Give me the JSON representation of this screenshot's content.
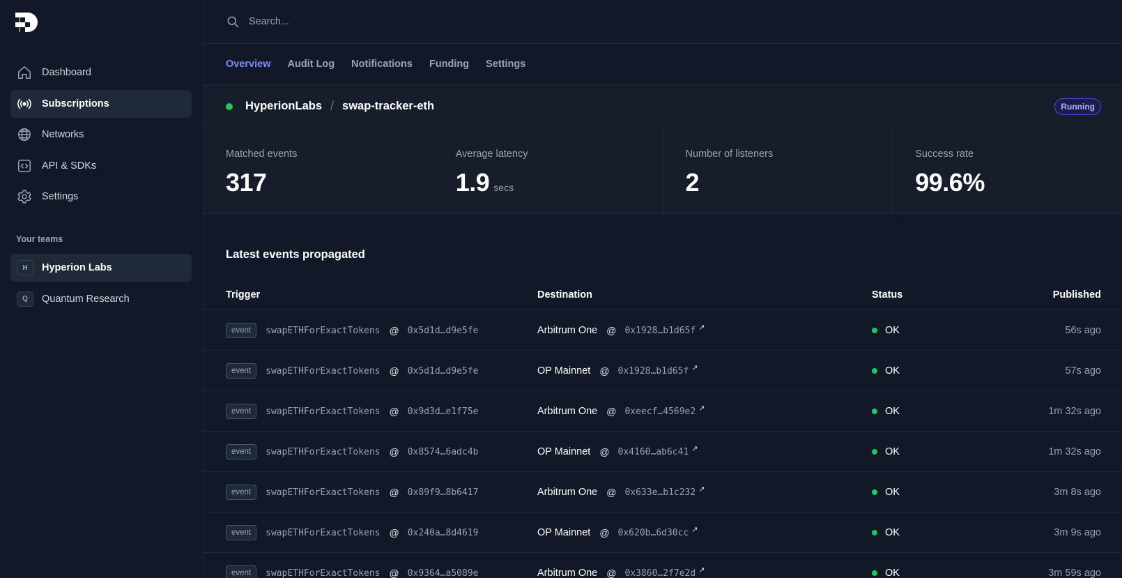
{
  "search": {
    "placeholder": "Search..."
  },
  "sidebar": {
    "nav": [
      {
        "label": "Dashboard",
        "icon": "home-icon"
      },
      {
        "label": "Subscriptions",
        "icon": "broadcast-icon",
        "active": true
      },
      {
        "label": "Networks",
        "icon": "globe-icon"
      },
      {
        "label": "API & SDKs",
        "icon": "code-icon"
      },
      {
        "label": "Settings",
        "icon": "gear-icon"
      }
    ],
    "teams_label": "Your teams",
    "teams": [
      {
        "initial": "H",
        "label": "Hyperion Labs",
        "active": true
      },
      {
        "initial": "Q",
        "label": "Quantum Research"
      }
    ]
  },
  "tabs": [
    {
      "label": "Overview",
      "active": true
    },
    {
      "label": "Audit Log"
    },
    {
      "label": "Notifications"
    },
    {
      "label": "Funding"
    },
    {
      "label": "Settings"
    }
  ],
  "header": {
    "org": "HyperionLabs",
    "separator": "/",
    "subscription": "swap-tracker-eth",
    "status": "Running"
  },
  "stats": [
    {
      "label": "Matched events",
      "value": "317",
      "unit": ""
    },
    {
      "label": "Average latency",
      "value": "1.9",
      "unit": "secs"
    },
    {
      "label": "Number of listeners",
      "value": "2",
      "unit": ""
    },
    {
      "label": "Success rate",
      "value": "99.6%",
      "unit": ""
    }
  ],
  "events": {
    "title": "Latest events propagated",
    "columns": {
      "trigger": "Trigger",
      "destination": "Destination",
      "status": "Status",
      "published": "Published"
    },
    "rows": [
      {
        "tag": "event",
        "fn": "swapETHForExactTokens",
        "at": "@",
        "src": "0x5d1d…d9e5fe",
        "dest": "Arbitrum One",
        "dest_addr": "0x1928…b1d65f",
        "status": "OK",
        "published": "56s ago"
      },
      {
        "tag": "event",
        "fn": "swapETHForExactTokens",
        "at": "@",
        "src": "0x5d1d…d9e5fe",
        "dest": "OP Mainnet",
        "dest_addr": "0x1928…b1d65f",
        "status": "OK",
        "published": "57s ago"
      },
      {
        "tag": "event",
        "fn": "swapETHForExactTokens",
        "at": "@",
        "src": "0x9d3d…e1f75e",
        "dest": "Arbitrum One",
        "dest_addr": "0xeecf…4569e2",
        "status": "OK",
        "published": "1m 32s ago"
      },
      {
        "tag": "event",
        "fn": "swapETHForExactTokens",
        "at": "@",
        "src": "0x8574…6adc4b",
        "dest": "OP Mainnet",
        "dest_addr": "0x4160…ab6c41",
        "status": "OK",
        "published": "1m 32s ago"
      },
      {
        "tag": "event",
        "fn": "swapETHForExactTokens",
        "at": "@",
        "src": "0x89f9…8b6417",
        "dest": "Arbitrum One",
        "dest_addr": "0x633e…b1c232",
        "status": "OK",
        "published": "3m 8s ago"
      },
      {
        "tag": "event",
        "fn": "swapETHForExactTokens",
        "at": "@",
        "src": "0x240a…8d4619",
        "dest": "OP Mainnet",
        "dest_addr": "0x620b…6d30cc",
        "status": "OK",
        "published": "3m 9s ago"
      },
      {
        "tag": "event",
        "fn": "swapETHForExactTokens",
        "at": "@",
        "src": "0x9364…a5089e",
        "dest": "Arbitrum One",
        "dest_addr": "0x3860…2f7e2d",
        "status": "OK",
        "published": "3m 59s ago"
      }
    ]
  },
  "colors": {
    "background": "#111827",
    "accent": "#818cf8",
    "success": "#22c55e"
  }
}
